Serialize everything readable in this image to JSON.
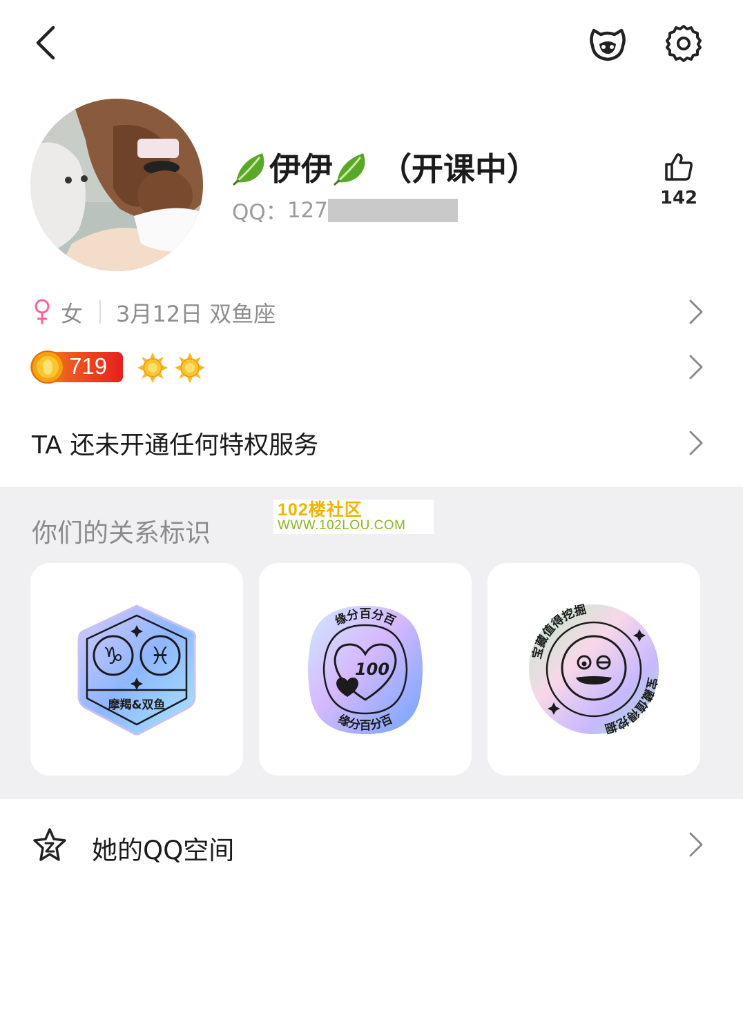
{
  "header": {
    "back_icon": "chevron-left-icon",
    "pet_icon": "pet-face-icon",
    "settings_icon": "gear-icon"
  },
  "profile": {
    "nickname_prefix": "伊伊",
    "nickname_suffix": "（开课中）",
    "qq_label": "QQ：",
    "qq_visible": "127",
    "like_count": "142"
  },
  "info": {
    "gender_symbol": "♀",
    "gender": "女",
    "birthday": "3月12日 双鱼座"
  },
  "level": {
    "value": "719",
    "crown_icons": [
      "sun-level-icon",
      "sun-level-icon"
    ]
  },
  "privilege": {
    "text": "TA 还未开通任何特权服务"
  },
  "relationship": {
    "title": "你们的关系标识",
    "watermark_line1": "102楼社区",
    "watermark_line2": "WWW.102LOU.COM",
    "badges": [
      {
        "label": "摩羯&双鱼",
        "symbols": [
          "♑",
          "♓"
        ]
      },
      {
        "arc_top": "缘分百分百",
        "arc_bottom": "缘分百分百",
        "number": "100"
      },
      {
        "arc_top": "宝藏值得挖掘",
        "arc_bottom": "宝藏值得挖掘"
      }
    ]
  },
  "zone": {
    "label": "她的QQ空间"
  },
  "colors": {
    "accent_gender": "#ff5fa0",
    "level_orange": "#f05a1f",
    "section_gray": "#f0f0f2",
    "text_muted": "#8d8d8d"
  }
}
